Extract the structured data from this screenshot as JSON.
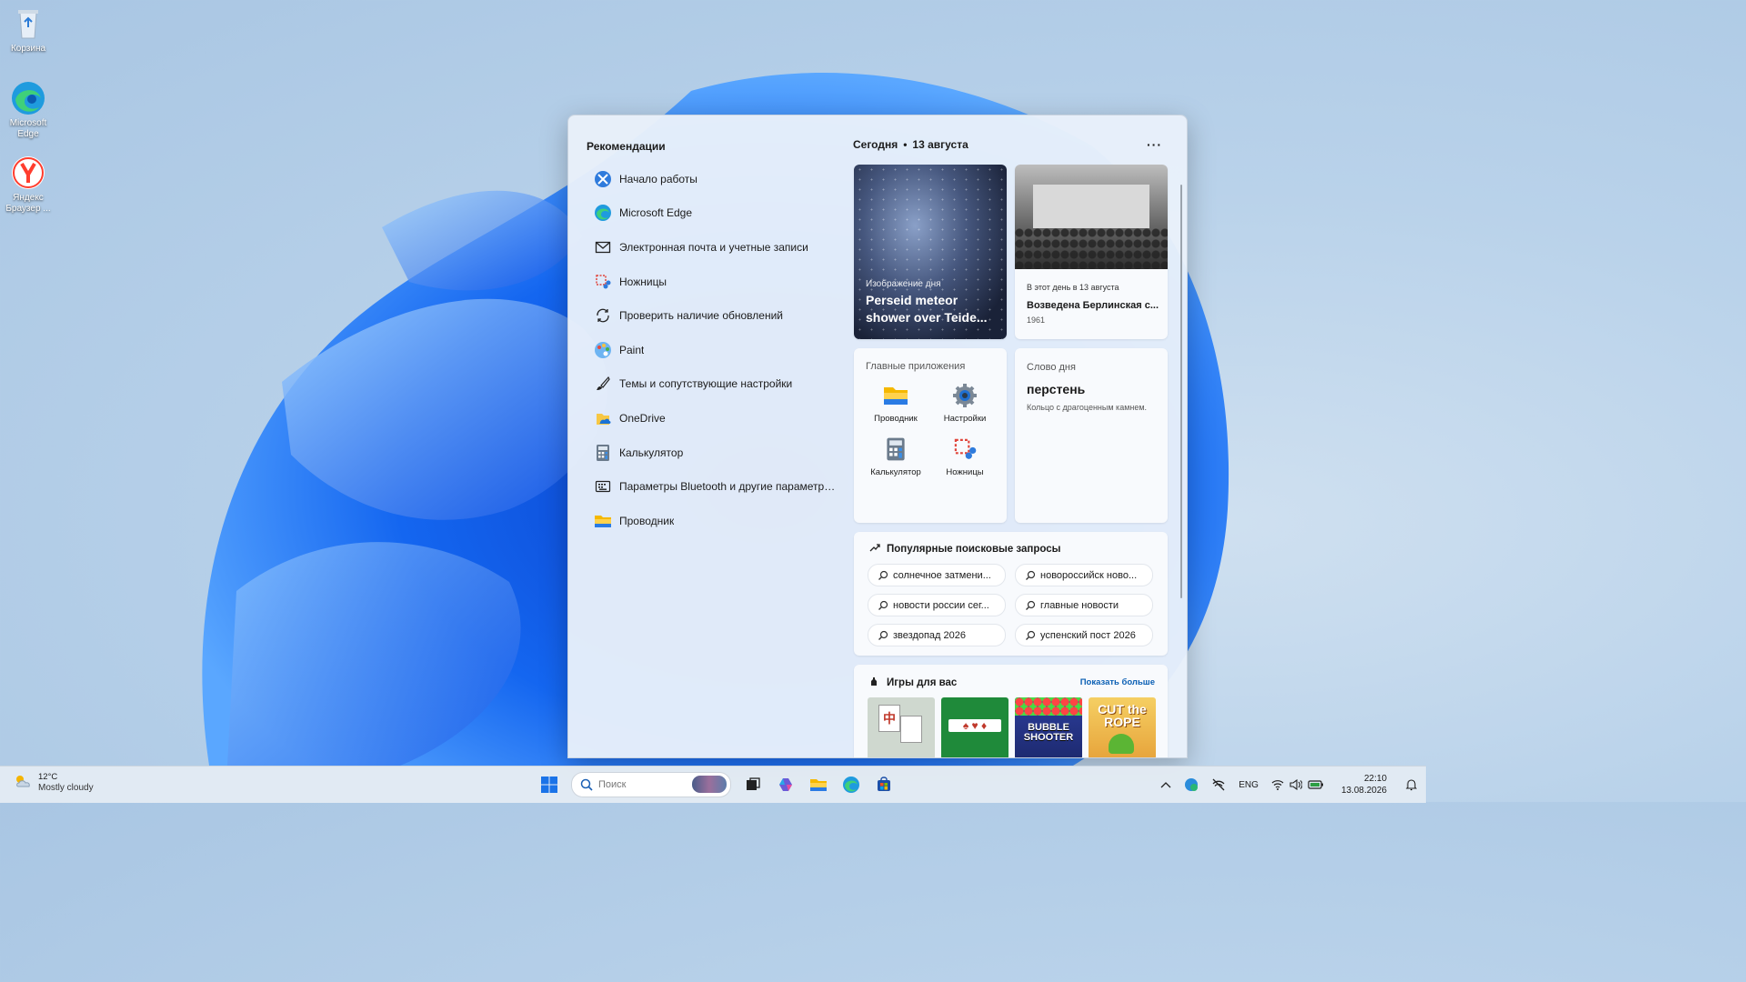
{
  "desktop": {
    "icons": [
      {
        "label": "Корзина",
        "icon": "recycle-bin-icon"
      },
      {
        "label": "Microsoft Edge",
        "icon": "edge-icon"
      },
      {
        "label": "Яндекс Браузер ...",
        "icon": "yandex-browser-icon"
      }
    ]
  },
  "flyout": {
    "recommendations": {
      "title": "Рекомендации",
      "items": [
        {
          "label": "Начало работы",
          "icon": "get-started-icon"
        },
        {
          "label": "Microsoft Edge",
          "icon": "edge-icon"
        },
        {
          "label": "Электронная почта и учетные записи",
          "icon": "mail-icon"
        },
        {
          "label": "Ножницы",
          "icon": "scissors-icon"
        },
        {
          "label": "Проверить наличие обновлений",
          "icon": "refresh-icon"
        },
        {
          "label": "Paint",
          "icon": "paint-icon"
        },
        {
          "label": "Темы и сопутствующие настройки",
          "icon": "brush-icon"
        },
        {
          "label": "OneDrive",
          "icon": "onedrive-icon"
        },
        {
          "label": "Калькулятор",
          "icon": "calculator-icon"
        },
        {
          "label": "Параметры Bluetooth и другие параметры у...",
          "icon": "keyboard-icon"
        },
        {
          "label": "Проводник",
          "icon": "folder-icon"
        }
      ]
    },
    "today": {
      "title": "Сегодня",
      "separator": "•",
      "date": "13 августа",
      "more": "···"
    },
    "image_of_day": {
      "kicker": "Изображение дня",
      "title": "Perseid meteor shower over Teide..."
    },
    "on_this_day": {
      "kicker": "В этот день в 13 августа",
      "title": "Возведена Берлинская с...",
      "year": "1961"
    },
    "top_apps": {
      "title": "Главные приложения",
      "apps": [
        {
          "label": "Проводник",
          "icon": "folder-icon"
        },
        {
          "label": "Настройки",
          "icon": "gear-icon"
        },
        {
          "label": "Калькулятор",
          "icon": "calculator-icon"
        },
        {
          "label": "Ножницы",
          "icon": "scissors-icon"
        }
      ]
    },
    "word_of_day": {
      "title": "Слово дня",
      "word": "перстень",
      "definition": "Кольцо с драгоценным камнем."
    },
    "trending": {
      "title": "Популярные поисковые запросы",
      "queries": [
        "солнечное затмени...",
        "новороссийск ново...",
        "новости россии сег...",
        "главные новости",
        "звездопад 2026",
        "успенский пост 2026"
      ]
    },
    "games": {
      "title": "Игры для вас",
      "show_more": "Показать больше",
      "items": [
        {
          "name": "mahjong",
          "art": "中"
        },
        {
          "name": "solitaire",
          "art": "♠ ♥ ♦"
        },
        {
          "name": "bubble-shooter",
          "art": "BUBBLE SHOOTER"
        },
        {
          "name": "cut-the-rope",
          "art": "CUT the ROPE"
        }
      ]
    }
  },
  "taskbar": {
    "weather": {
      "temp": "12°C",
      "desc": "Mostly cloudy"
    },
    "search_placeholder": "Поиск",
    "language": "ENG",
    "time": "22:10",
    "date": "13.08.2026"
  }
}
